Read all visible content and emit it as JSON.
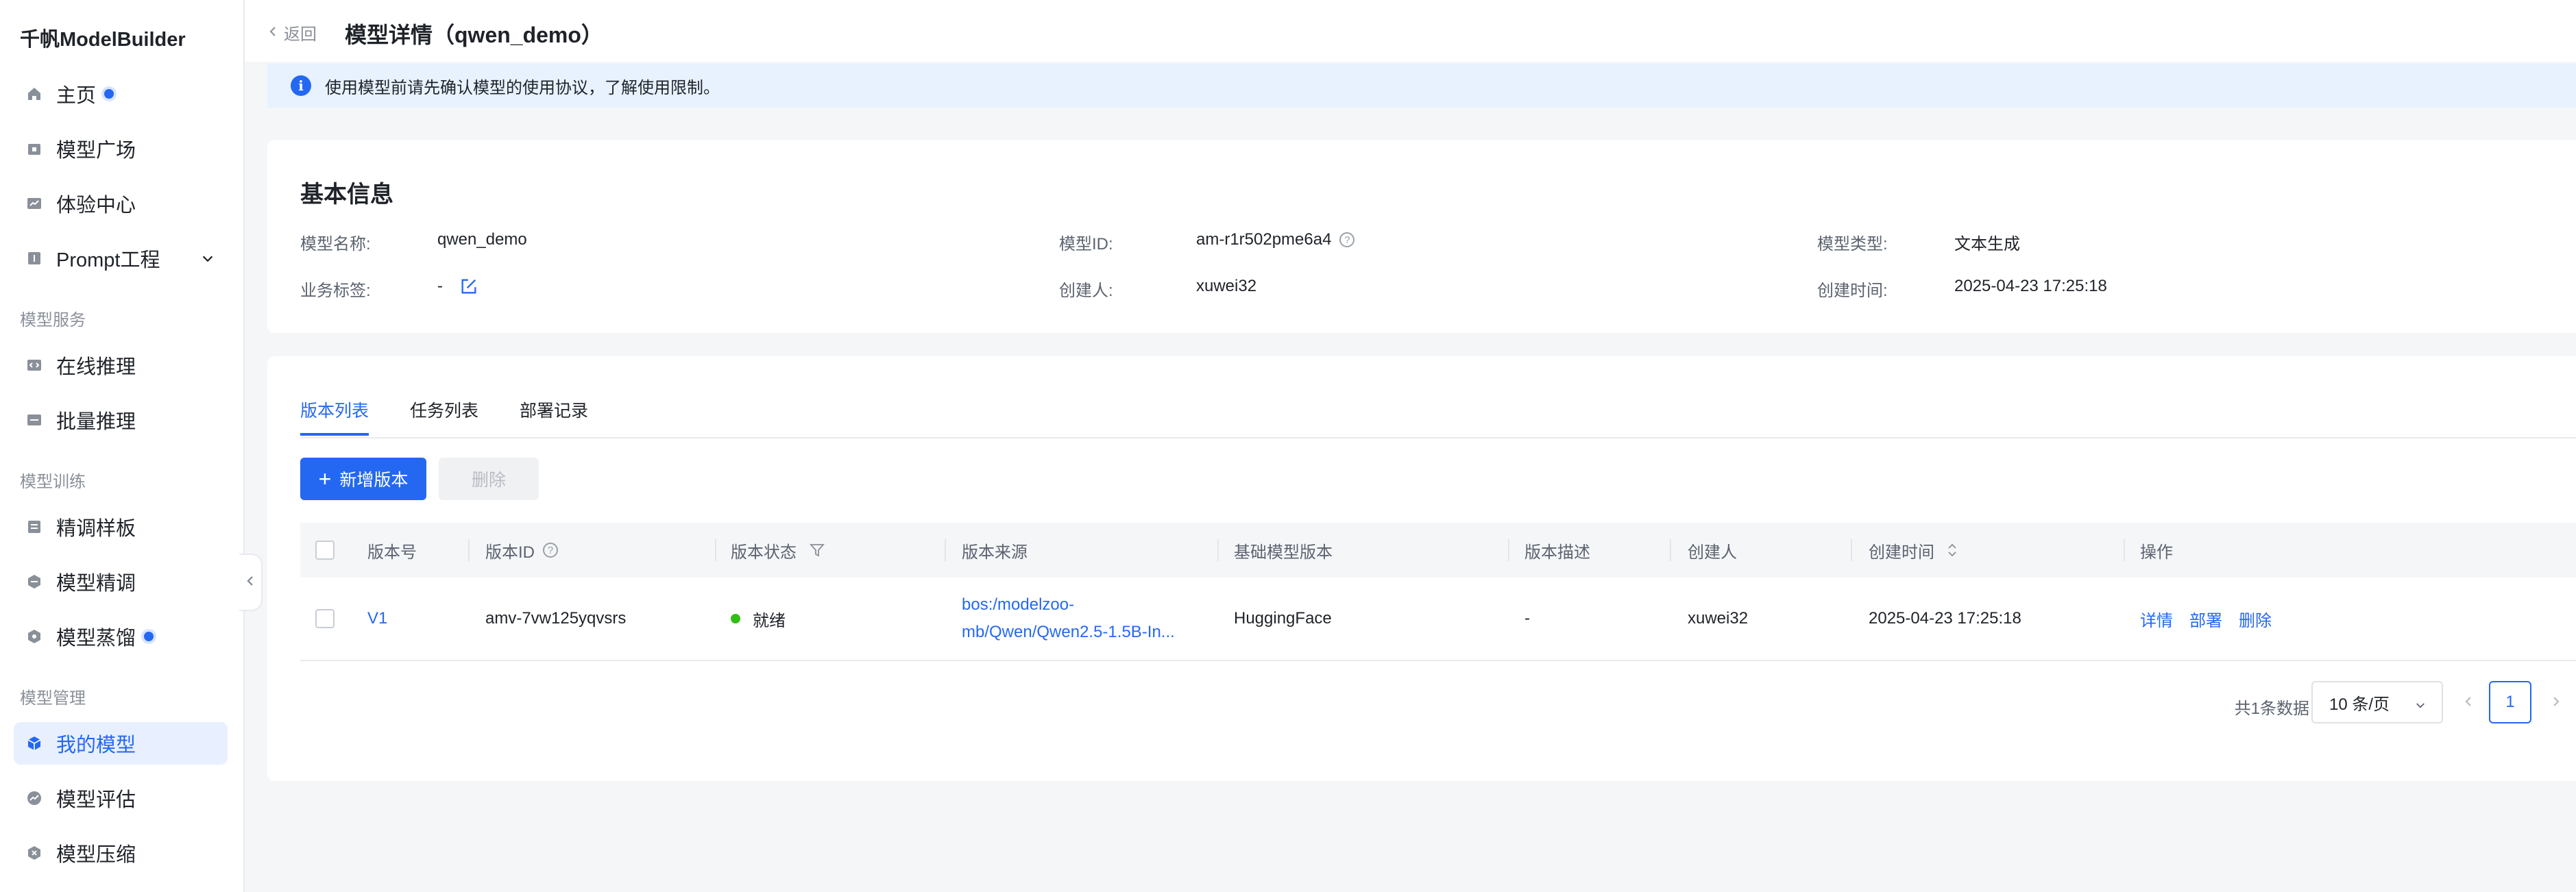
{
  "app": {
    "name": "千帆ModelBuilder"
  },
  "sidebar": {
    "items": [
      {
        "label": "主页"
      },
      {
        "label": "模型广场"
      },
      {
        "label": "体验中心"
      },
      {
        "label": "Prompt工程"
      },
      {
        "label": "在线推理"
      },
      {
        "label": "批量推理"
      },
      {
        "label": "精调样板"
      },
      {
        "label": "模型精调"
      },
      {
        "label": "模型蒸馏"
      },
      {
        "label": "我的模型"
      },
      {
        "label": "模型评估"
      },
      {
        "label": "模型压缩"
      }
    ],
    "groups": [
      "模型服务",
      "模型训练",
      "模型管理"
    ],
    "active": "我的模型",
    "accent": "#2468f2"
  },
  "header": {
    "back_label": "返回",
    "title": "模型详情（qwen_demo）"
  },
  "notice": {
    "text": "使用模型前请先确认模型的使用协议，了解使用限制。"
  },
  "basic_info": {
    "title": "基本信息",
    "name_label": "模型名称:",
    "name_value": "qwen_demo",
    "id_label": "模型ID:",
    "id_value": "am-r1r502pme6a4",
    "type_label": "模型类型:",
    "type_value": "文本生成",
    "tags_label": "业务标签:",
    "tags_value": "-",
    "creator_label": "创建人:",
    "creator_value": "xuwei32",
    "created_label": "创建时间:",
    "created_value": "2025-04-23 17:25:18"
  },
  "tabs": [
    {
      "label": "版本列表"
    },
    {
      "label": "任务列表"
    },
    {
      "label": "部署记录"
    }
  ],
  "actions": {
    "add_label": "新增版本",
    "delete_label": "删除"
  },
  "table": {
    "headers": [
      "版本号",
      "版本ID",
      "版本状态",
      "版本来源",
      "基础模型版本",
      "版本描述",
      "创建人",
      "创建时间",
      "操作"
    ],
    "rows": [
      {
        "version": "V1",
        "version_id": "amv-7vw125yqvsrs",
        "status": "就绪",
        "source_line1": "bos:/modelzoo-",
        "source_line2": "mb/Qwen/Qwen2.5-1.5B-In...",
        "base_model": "HuggingFace",
        "description": "-",
        "creator": "xuwei32",
        "created": "2025-04-23 17:25:18",
        "ops": [
          "详情",
          "部署",
          "删除"
        ]
      }
    ]
  },
  "pagination": {
    "total_text": "共1条数据",
    "page_size": "10 条/页",
    "current_page": "1"
  },
  "colors": {
    "primary": "#2468f2",
    "status_ready": "#30bf13"
  }
}
